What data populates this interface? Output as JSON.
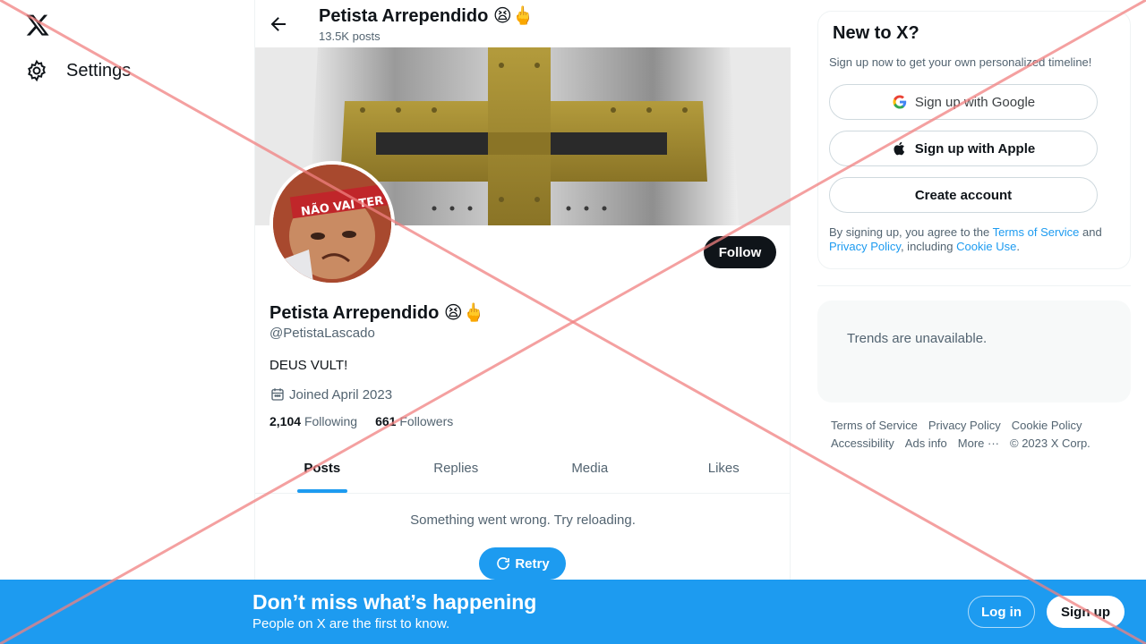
{
  "nav": {
    "settings_label": "Settings"
  },
  "profile": {
    "top_name": "Petista Arrependido 😫🖕",
    "posts_count": "13.5K posts",
    "name": "Petista Arrependido 😫🖕",
    "handle": "@PetistaLascado",
    "bio": "DEUS VULT!",
    "joined": "Joined April 2023",
    "following_count": "2,104",
    "following_label": "Following",
    "followers_count": "661",
    "followers_label": "Followers",
    "follow_label": "Follow",
    "avatar_text": "NÃO VAI TER G"
  },
  "tabs": [
    {
      "label": "Posts",
      "active": true
    },
    {
      "label": "Replies"
    },
    {
      "label": "Media"
    },
    {
      "label": "Likes"
    }
  ],
  "feed": {
    "error_text": "Something went wrong. Try reloading.",
    "retry_label": "Retry"
  },
  "signup_card": {
    "title": "New to X?",
    "subtitle": "Sign up now to get your own personalized timeline!",
    "google_label": "Sign up with Google",
    "apple_label": "Sign up with Apple",
    "create_label": "Create account",
    "legal_prefix": "By signing up, you agree to the ",
    "tos": "Terms of Service",
    "and": " and ",
    "privacy": "Privacy Policy",
    "including": ", including ",
    "cookie": "Cookie Use",
    "end": "."
  },
  "trends": {
    "text": "Trends are unavailable."
  },
  "footer": {
    "links": [
      "Terms of Service",
      "Privacy Policy",
      "Cookie Policy",
      "Accessibility",
      "Ads info",
      "More ···"
    ],
    "copyright": "© 2023 X Corp."
  },
  "bottom_bar": {
    "title": "Don’t miss what’s happening",
    "subtitle": "People on X are the first to know.",
    "login_label": "Log in",
    "signup_label": "Sign up"
  },
  "colors": {
    "accent": "#1d9bf0",
    "text_primary": "#0f1419",
    "text_secondary": "#536471",
    "overlay_x": "#f08080"
  }
}
